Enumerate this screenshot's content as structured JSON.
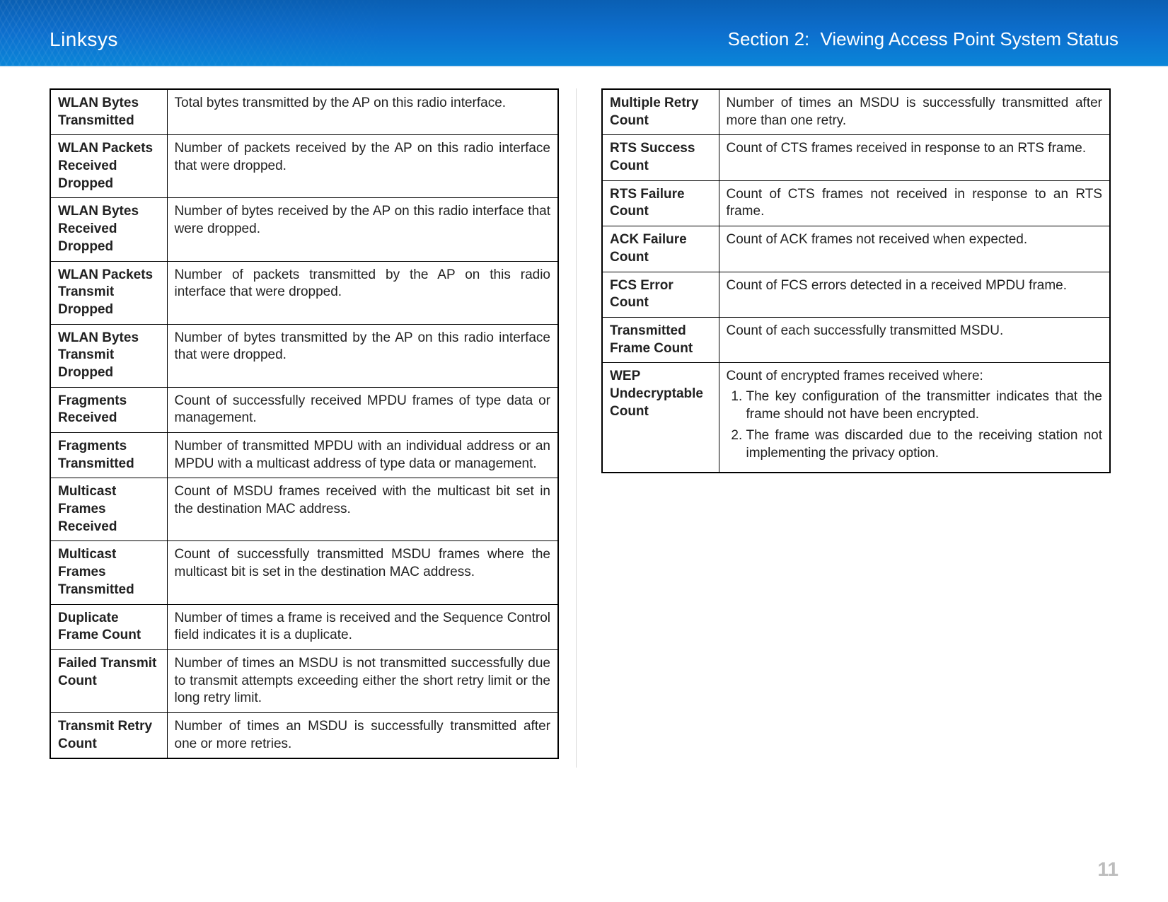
{
  "header": {
    "brand": "Linksys",
    "section_label": "Section 2:",
    "section_title": "Viewing Access Point System Status"
  },
  "left_table": [
    {
      "name": "WLAN Bytes Transmitted",
      "desc": "Total bytes transmitted by the AP on this radio interface."
    },
    {
      "name": "WLAN Packets Received Dropped",
      "desc": "Number of packets received by the AP on this radio interface that were dropped."
    },
    {
      "name": "WLAN Bytes Received Dropped",
      "desc": "Number of bytes received by the AP on this radio interface that were dropped."
    },
    {
      "name": "WLAN Packets Transmit Dropped",
      "desc": "Number of packets transmitted by the AP on this radio interface that were dropped."
    },
    {
      "name": "WLAN Bytes Transmit Dropped",
      "desc": "Number of bytes transmitted by the AP on this radio interface that were dropped."
    },
    {
      "name": "Fragments Received",
      "desc": "Count of successfully received MPDU frames of type data or management."
    },
    {
      "name": "Fragments Transmitted",
      "desc": "Number of transmitted MPDU with an individual address or an MPDU with a multicast address of type data or management."
    },
    {
      "name": "Multicast Frames Received",
      "desc": "Count of MSDU frames received with the multicast bit set in the destination MAC address."
    },
    {
      "name": "Multicast Frames Transmitted",
      "desc": "Count of successfully transmitted MSDU frames where the multicast bit is set in the destination MAC address."
    },
    {
      "name": "Duplicate Frame Count",
      "desc": "Number of times a frame is received and the Sequence Control field indicates it is a duplicate."
    },
    {
      "name": "Failed Transmit Count",
      "desc": "Number of times an MSDU is not transmitted successfully due to transmit attempts exceeding either the short retry limit or the long retry limit."
    },
    {
      "name": "Transmit Retry Count",
      "desc": "Number of times an MSDU is successfully transmitted after one or more retries."
    }
  ],
  "right_table": [
    {
      "name": "Multiple Retry Count",
      "desc": "Number of times an MSDU is successfully transmitted after more than one retry."
    },
    {
      "name": "RTS Success Count",
      "desc": "Count of CTS frames received in response to an RTS frame."
    },
    {
      "name": "RTS Failure Count",
      "desc": "Count of CTS frames not received in response to an RTS frame."
    },
    {
      "name": "ACK Failure Count",
      "desc": "Count of ACK frames not received when expected."
    },
    {
      "name": "FCS Error Count",
      "desc": "Count of FCS errors detected in a received MPDU frame."
    },
    {
      "name": "Transmitted Frame Count",
      "desc": "Count of each successfully transmitted MSDU."
    },
    {
      "name": "WEP Undecryptable Count",
      "desc_intro": "Count of encrypted frames received where:",
      "list": [
        "The key configuration of the transmitter indicates that the frame should not have been encrypted.",
        "The frame was discarded due to the receiving station not implementing the privacy option."
      ]
    }
  ],
  "page_number": "11"
}
